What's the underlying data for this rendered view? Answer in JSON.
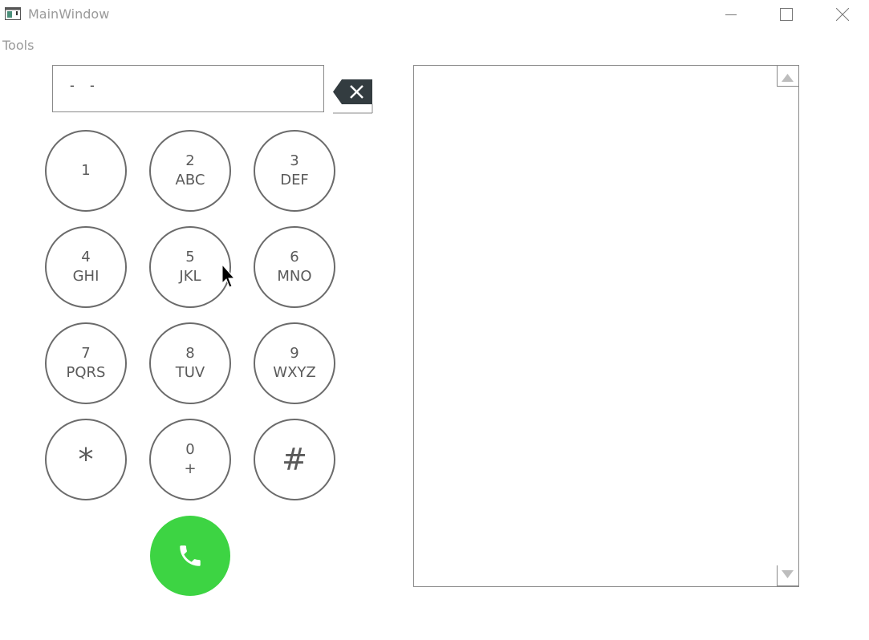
{
  "window": {
    "title": "MainWindow",
    "icon": "app-window-icon",
    "controls": [
      "minimize-icon",
      "maximize-icon",
      "close-icon"
    ]
  },
  "menu": {
    "tools_label": "Tools"
  },
  "dialer": {
    "number_value": "-   -",
    "backspace_icon": "backspace-icon",
    "keys": [
      {
        "digit": "1",
        "letters": ""
      },
      {
        "digit": "2",
        "letters": "ABC"
      },
      {
        "digit": "3",
        "letters": "DEF"
      },
      {
        "digit": "4",
        "letters": "GHI"
      },
      {
        "digit": "5",
        "letters": "JKL"
      },
      {
        "digit": "6",
        "letters": "MNO"
      },
      {
        "digit": "7",
        "letters": "PQRS"
      },
      {
        "digit": "8",
        "letters": "TUV"
      },
      {
        "digit": "9",
        "letters": "WXYZ"
      },
      {
        "digit": "*",
        "letters": ""
      },
      {
        "digit": "0",
        "letters": "+"
      },
      {
        "digit": "#",
        "letters": ""
      }
    ],
    "call_icon": "phone-icon",
    "call_color": "#3dd443"
  },
  "log": {
    "content": ""
  }
}
